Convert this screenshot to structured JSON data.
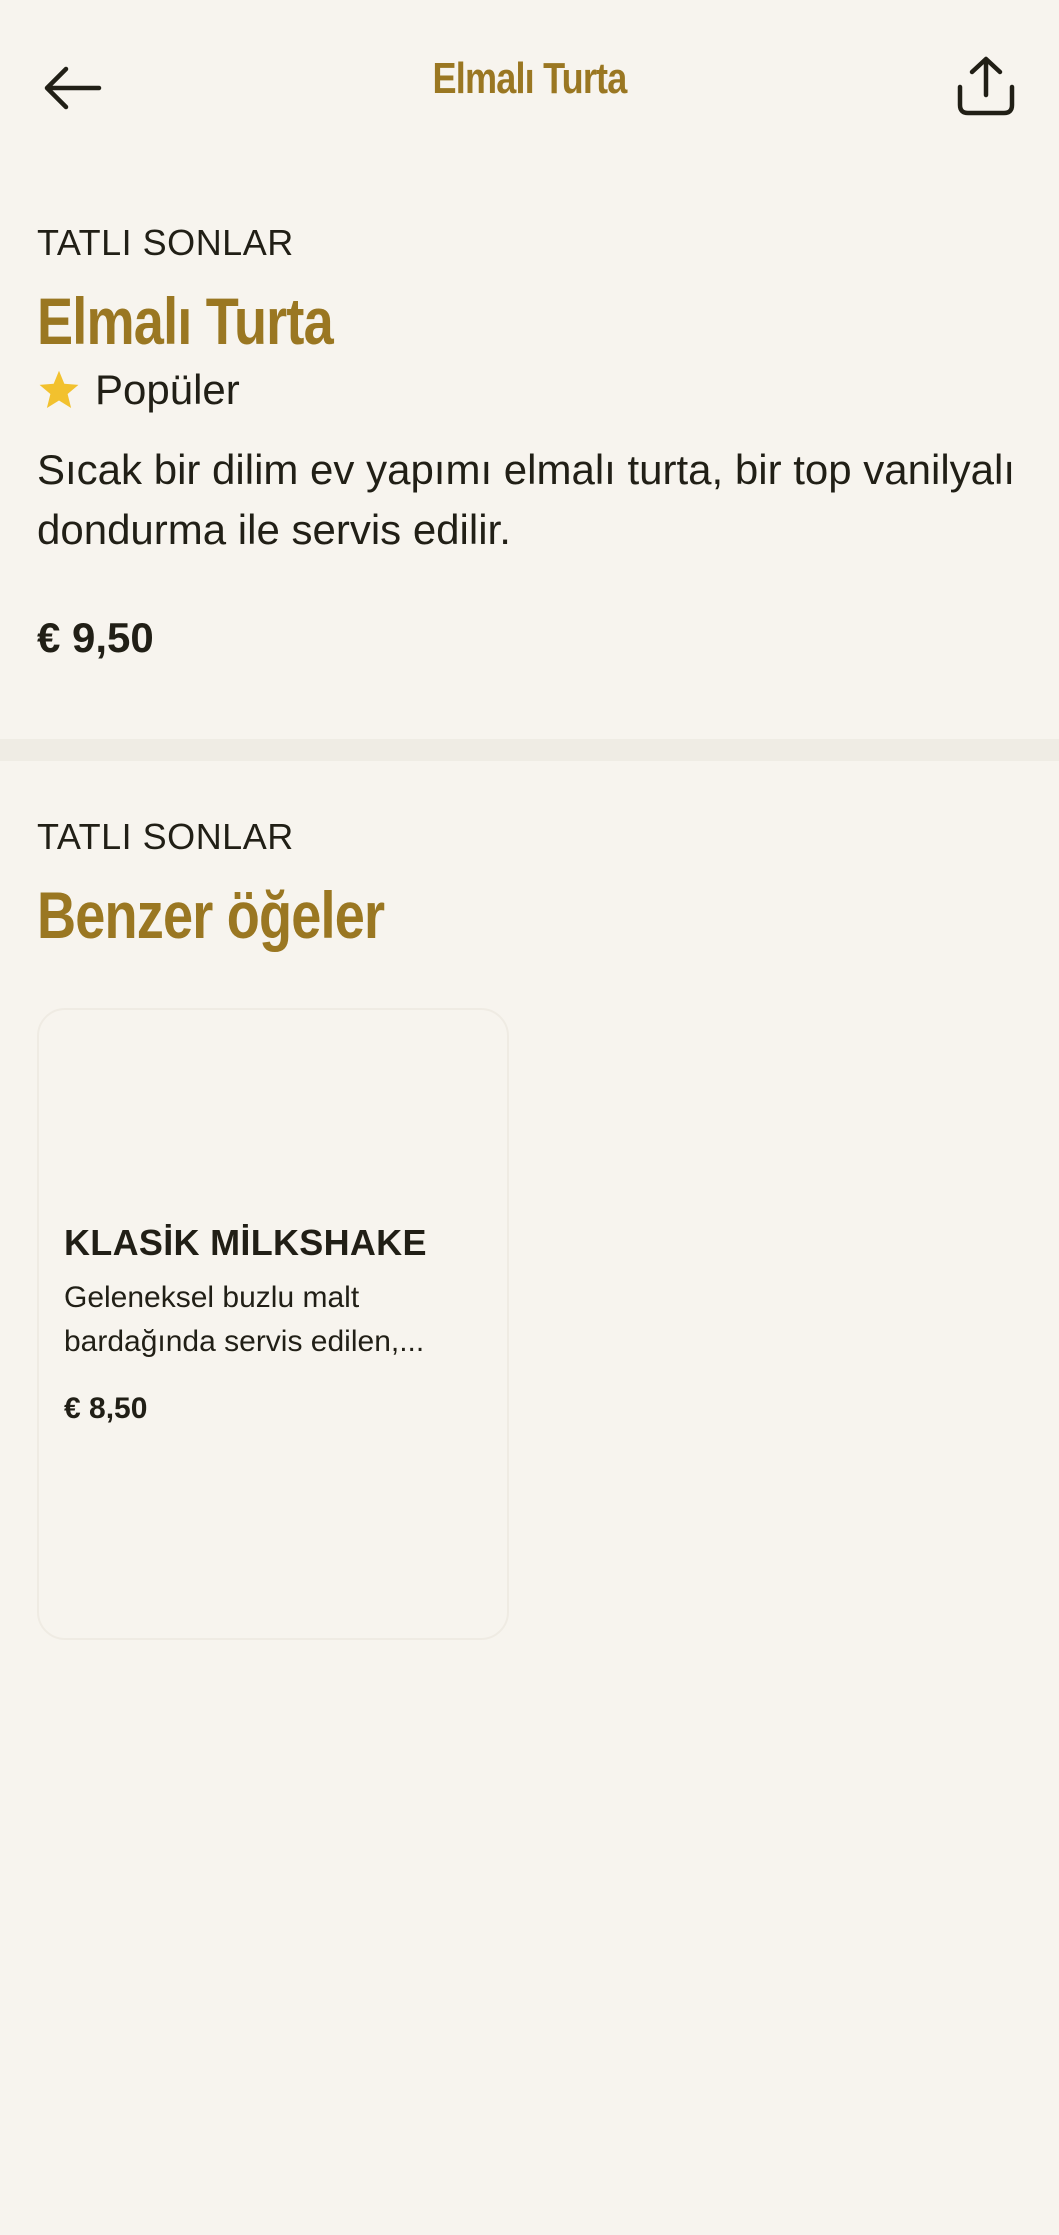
{
  "header": {
    "title": "Elmalı Turta",
    "back_icon": "arrow-left-icon",
    "share_icon": "share-icon"
  },
  "item": {
    "category": "TATLI SONLAR",
    "name": "Elmalı Turta",
    "badge_icon": "star-icon",
    "badge_label": "Popüler",
    "description": "Sıcak bir dilim ev yapımı elmalı turta, bir top vanilyalı dondurma ile servis edilir.",
    "price": "€ 9,50"
  },
  "similar": {
    "category": "TATLI SONLAR",
    "title": "Benzer öğeler",
    "items": [
      {
        "name": "KLASİK MİLKSHAKE",
        "description": "Geleneksel buzlu malt bardağında servis edilen,...",
        "price": "€ 8,50"
      }
    ]
  },
  "colors": {
    "background": "#f7f4ee",
    "accent": "#9a7722",
    "text": "#211f16",
    "star": "#f2c12e"
  }
}
